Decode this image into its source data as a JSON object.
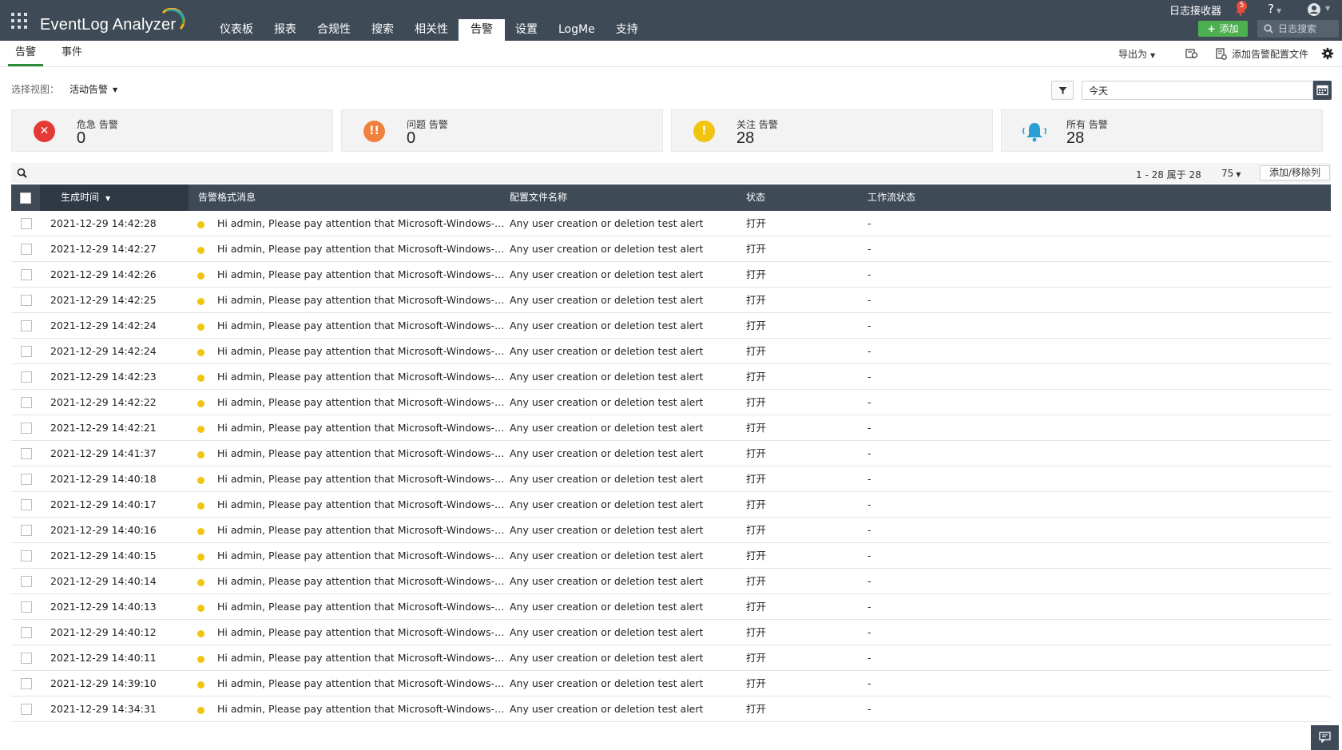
{
  "app": {
    "brand": "EventLog Analyzer",
    "nav": [
      {
        "label": "仪表板"
      },
      {
        "label": "报表"
      },
      {
        "label": "合规性"
      },
      {
        "label": "搜索"
      },
      {
        "label": "相关性"
      },
      {
        "label": "告警",
        "active": true
      },
      {
        "label": "设置"
      },
      {
        "label": "LogMe"
      },
      {
        "label": "支持"
      }
    ],
    "log_receiver": "日志接收器",
    "notification_count": "5",
    "help": "?",
    "add_label": "添加",
    "log_search_placeholder": "日志搜索"
  },
  "subnav": {
    "tabs": [
      {
        "label": "告警",
        "active": true
      },
      {
        "label": "事件"
      }
    ],
    "export_label": "导出为",
    "add_profile_label": "添加告警配置文件"
  },
  "filters": {
    "view_label": "选择视图：",
    "view_value": "活动告警",
    "date_value": "今天"
  },
  "summary": [
    {
      "label": "危急 告警",
      "count": "0",
      "color": "#e53935",
      "icon": "critical-x-icon"
    },
    {
      "label": "问题 告警",
      "count": "0",
      "color": "#f0803c",
      "icon": "trouble-exclamation-icon"
    },
    {
      "label": "关注 告警",
      "count": "28",
      "color": "#f1c40f",
      "icon": "attention-exclamation-icon"
    },
    {
      "label": "所有 告警",
      "count": "28",
      "color": "#2a9fd6",
      "icon": "bell-icon"
    }
  ],
  "table": {
    "pagination": "1 - 28 属于 28",
    "page_size": "75",
    "add_remove_columns": "添加/移除列",
    "columns": [
      "生成时间",
      "告警格式消息",
      "配置文件名称",
      "状态",
      "工作流状态"
    ],
    "rows": [
      {
        "time": "2021-12-29 14:42:28",
        "message": "Hi admin, Please pay attention that Microsoft-Windows-Security-Auditing",
        "profile": "Any user creation or deletion test alert",
        "status": "打开",
        "workflow": "-"
      },
      {
        "time": "2021-12-29 14:42:27",
        "message": "Hi admin, Please pay attention that Microsoft-Windows-Security-Auditing",
        "profile": "Any user creation or deletion test alert",
        "status": "打开",
        "workflow": "-"
      },
      {
        "time": "2021-12-29 14:42:26",
        "message": "Hi admin, Please pay attention that Microsoft-Windows-Security-Auditing",
        "profile": "Any user creation or deletion test alert",
        "status": "打开",
        "workflow": "-"
      },
      {
        "time": "2021-12-29 14:42:25",
        "message": "Hi admin, Please pay attention that Microsoft-Windows-Security-Auditing",
        "profile": "Any user creation or deletion test alert",
        "status": "打开",
        "workflow": "-"
      },
      {
        "time": "2021-12-29 14:42:24",
        "message": "Hi admin, Please pay attention that Microsoft-Windows-Security-Auditing",
        "profile": "Any user creation or deletion test alert",
        "status": "打开",
        "workflow": "-"
      },
      {
        "time": "2021-12-29 14:42:24",
        "message": "Hi admin, Please pay attention that Microsoft-Windows-Security-Auditing",
        "profile": "Any user creation or deletion test alert",
        "status": "打开",
        "workflow": "-"
      },
      {
        "time": "2021-12-29 14:42:23",
        "message": "Hi admin, Please pay attention that Microsoft-Windows-Security-Auditing",
        "profile": "Any user creation or deletion test alert",
        "status": "打开",
        "workflow": "-"
      },
      {
        "time": "2021-12-29 14:42:22",
        "message": "Hi admin, Please pay attention that Microsoft-Windows-Security-Auditing",
        "profile": "Any user creation or deletion test alert",
        "status": "打开",
        "workflow": "-"
      },
      {
        "time": "2021-12-29 14:42:21",
        "message": "Hi admin, Please pay attention that Microsoft-Windows-Security-Auditing",
        "profile": "Any user creation or deletion test alert",
        "status": "打开",
        "workflow": "-"
      },
      {
        "time": "2021-12-29 14:41:37",
        "message": "Hi admin, Please pay attention that Microsoft-Windows-Security-Auditing",
        "profile": "Any user creation or deletion test alert",
        "status": "打开",
        "workflow": "-"
      },
      {
        "time": "2021-12-29 14:40:18",
        "message": "Hi admin, Please pay attention that Microsoft-Windows-Security-Auditing",
        "profile": "Any user creation or deletion test alert",
        "status": "打开",
        "workflow": "-"
      },
      {
        "time": "2021-12-29 14:40:17",
        "message": "Hi admin, Please pay attention that Microsoft-Windows-Security-Auditing",
        "profile": "Any user creation or deletion test alert",
        "status": "打开",
        "workflow": "-"
      },
      {
        "time": "2021-12-29 14:40:16",
        "message": "Hi admin, Please pay attention that Microsoft-Windows-Security-Auditing",
        "profile": "Any user creation or deletion test alert",
        "status": "打开",
        "workflow": "-"
      },
      {
        "time": "2021-12-29 14:40:15",
        "message": "Hi admin, Please pay attention that Microsoft-Windows-Security-Auditing",
        "profile": "Any user creation or deletion test alert",
        "status": "打开",
        "workflow": "-"
      },
      {
        "time": "2021-12-29 14:40:14",
        "message": "Hi admin, Please pay attention that Microsoft-Windows-Security-Auditing",
        "profile": "Any user creation or deletion test alert",
        "status": "打开",
        "workflow": "-"
      },
      {
        "time": "2021-12-29 14:40:13",
        "message": "Hi admin, Please pay attention that Microsoft-Windows-Security-Auditing",
        "profile": "Any user creation or deletion test alert",
        "status": "打开",
        "workflow": "-"
      },
      {
        "time": "2021-12-29 14:40:12",
        "message": "Hi admin, Please pay attention that Microsoft-Windows-Security-Auditing",
        "profile": "Any user creation or deletion test alert",
        "status": "打开",
        "workflow": "-"
      },
      {
        "time": "2021-12-29 14:40:11",
        "message": "Hi admin, Please pay attention that Microsoft-Windows-Security-Auditing",
        "profile": "Any user creation or deletion test alert",
        "status": "打开",
        "workflow": "-"
      },
      {
        "time": "2021-12-29 14:39:10",
        "message": "Hi admin, Please pay attention that Microsoft-Windows-Security-Auditing",
        "profile": "Any user creation or deletion test alert",
        "status": "打开",
        "workflow": "-"
      },
      {
        "time": "2021-12-29 14:34:31",
        "message": "Hi admin, Please pay attention that Microsoft-Windows-Security-Auditing",
        "profile": "Any user creation or deletion test alert",
        "status": "打开",
        "workflow": "-"
      }
    ]
  }
}
